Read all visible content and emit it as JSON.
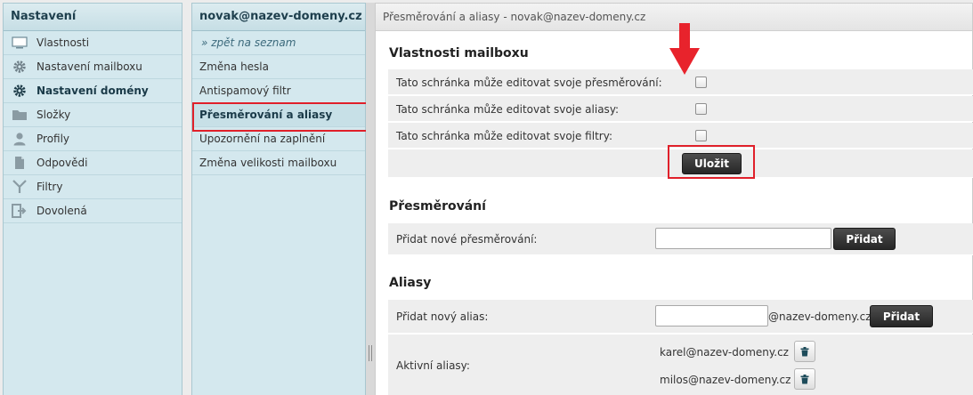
{
  "left_panel": {
    "title": "Nastavení",
    "items": [
      {
        "label": "Vlastnosti",
        "icon": "monitor-icon"
      },
      {
        "label": "Nastavení mailboxu",
        "icon": "gear-icon"
      },
      {
        "label": "Nastavení domény",
        "icon": "gear-icon",
        "active": true
      },
      {
        "label": "Složky",
        "icon": "folder-icon"
      },
      {
        "label": "Profily",
        "icon": "user-icon"
      },
      {
        "label": "Odpovědi",
        "icon": "document-icon"
      },
      {
        "label": "Filtry",
        "icon": "filter-icon"
      },
      {
        "label": "Dovolená",
        "icon": "exit-icon"
      }
    ]
  },
  "middle_panel": {
    "title": "novak@nazev-domeny.cz",
    "back_link": "» zpět na seznam",
    "items": [
      {
        "label": "Změna hesla"
      },
      {
        "label": "Antispamový filtr"
      },
      {
        "label": "Přesměrování a aliasy",
        "selected": true
      },
      {
        "label": "Upozornění na zaplnění"
      },
      {
        "label": "Změna velikosti mailboxu"
      }
    ]
  },
  "main": {
    "title": "Přesměrování a aliasy - novak@nazev-domeny.cz",
    "mailbox_props": {
      "heading": "Vlastnosti mailboxu",
      "options": [
        {
          "label": "Tato schránka může editovat svoje přesměrování:",
          "checked": false
        },
        {
          "label": "Tato schránka může editovat svoje aliasy:",
          "checked": false
        },
        {
          "label": "Tato schránka může editovat svoje filtry:",
          "checked": false
        }
      ],
      "save_label": "Uložit"
    },
    "redirect": {
      "heading": "Přesměrování",
      "add_label": "Přidat nové přesměrování:",
      "input_value": "",
      "add_button": "Přidat"
    },
    "aliases": {
      "heading": "Aliasy",
      "add_label": "Přidat nový alias:",
      "input_value": "",
      "domain_suffix": "@nazev-domeny.cz",
      "add_button": "Přidat",
      "active_label": "Aktivní aliasy:",
      "active": [
        "karel@nazev-domeny.cz",
        "milos@nazev-domeny.cz"
      ]
    }
  },
  "colors": {
    "panel_bg": "#d4e8ee",
    "highlight": "#e0202a",
    "button": "#2f2f2f"
  }
}
